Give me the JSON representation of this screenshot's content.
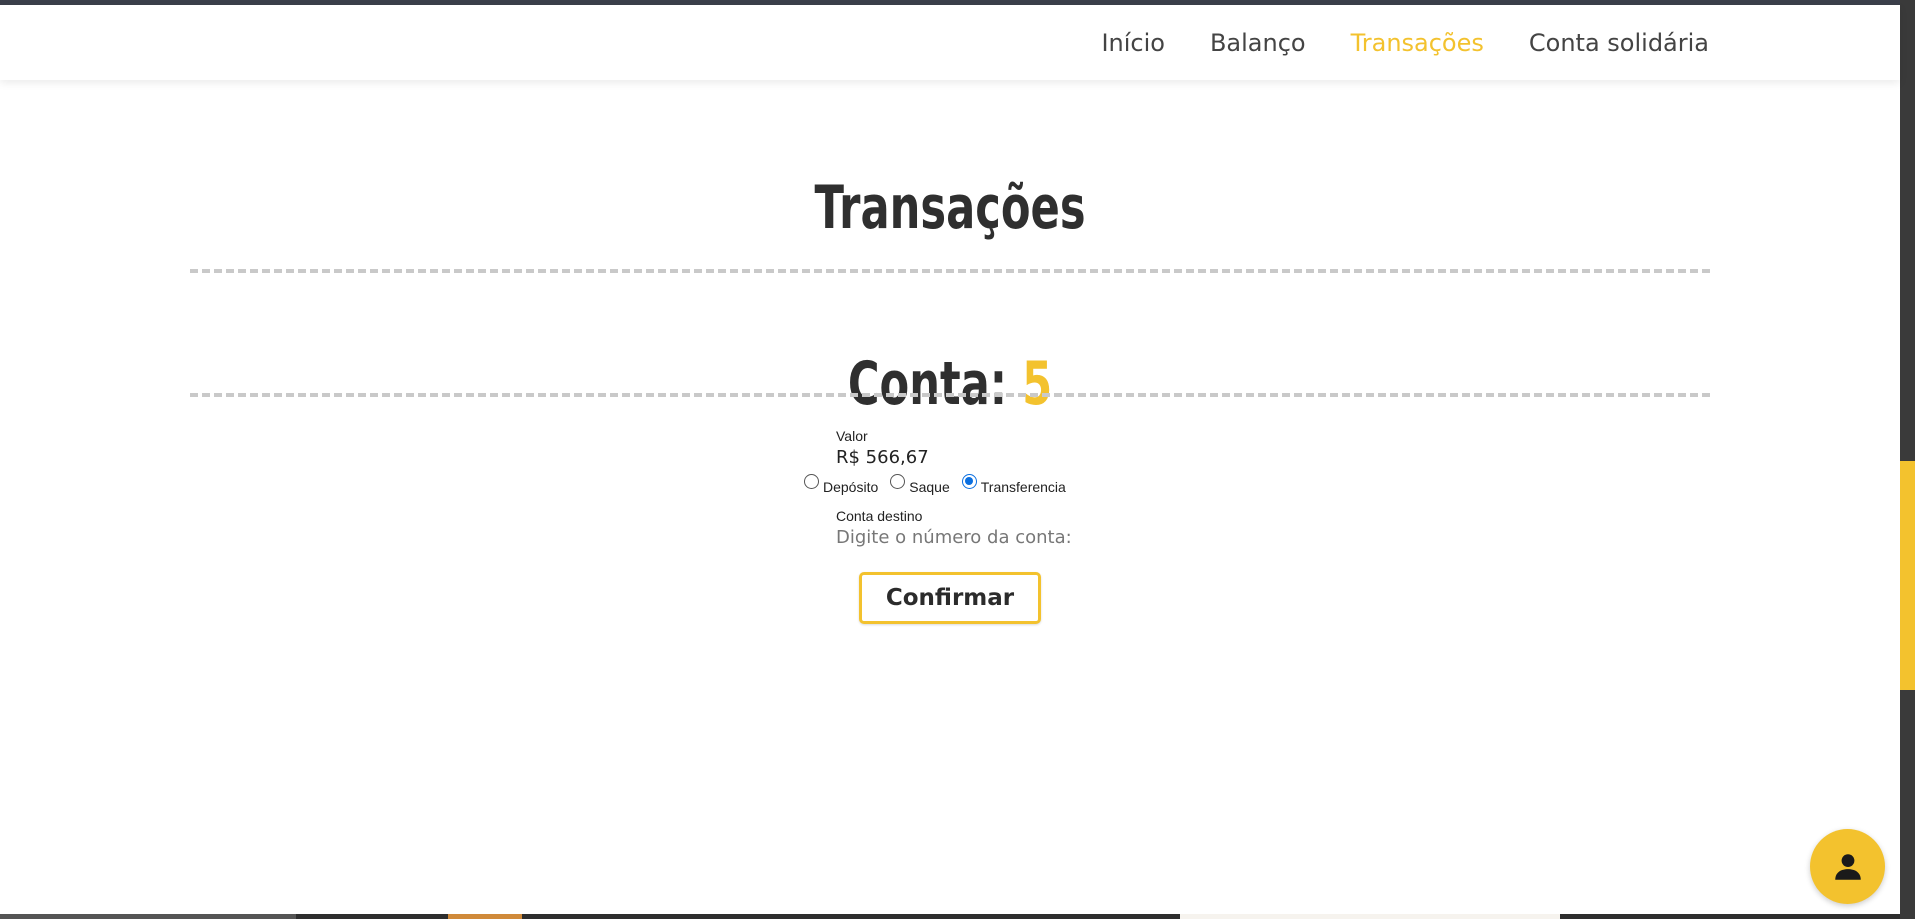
{
  "nav": {
    "items": [
      {
        "label": "Início",
        "active": false
      },
      {
        "label": "Balanço",
        "active": false
      },
      {
        "label": "Transações",
        "active": true
      },
      {
        "label": "Conta solidária",
        "active": false
      }
    ]
  },
  "main": {
    "title": "Transações",
    "account_label": "Conta:",
    "account_number": "5"
  },
  "form": {
    "valor_label": "Valor",
    "valor_value": "R$ 566,67",
    "radios": [
      {
        "label": "Depósito",
        "checked": false
      },
      {
        "label": "Saque",
        "checked": false
      },
      {
        "label": "Transferencia",
        "checked": true
      }
    ],
    "destino_label": "Conta destino",
    "destino_placeholder": "Digite o número da conta:",
    "confirm_label": "Confirmar"
  },
  "colors": {
    "accent": "#f3c22e",
    "text": "#2f2f2f",
    "radio_checked": "#0b6fe0"
  },
  "icons": {
    "fab": "person-icon"
  }
}
